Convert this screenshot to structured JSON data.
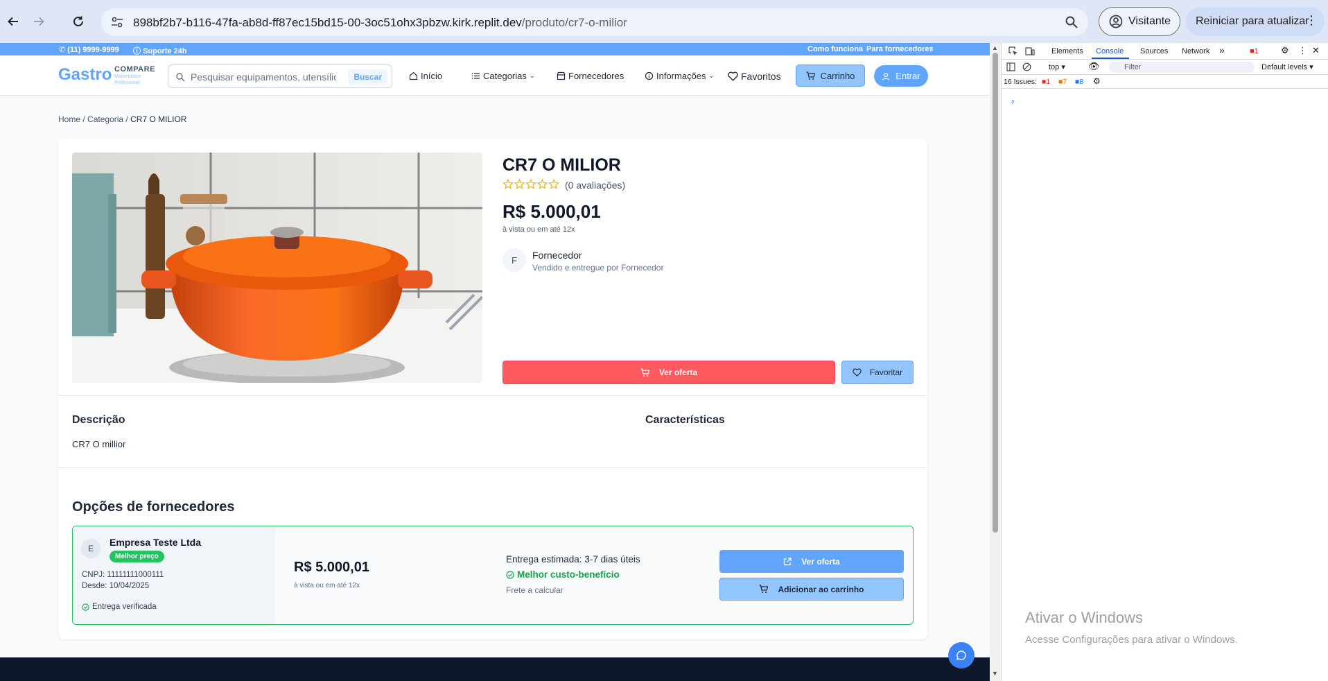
{
  "browser": {
    "url_host": "898bf2b7-b116-47fa-ab8d-ff87ec15bd15-00-3oc51ohx3pbzw.kirk.replit.dev",
    "url_path": "/produto/cr7-o-milior",
    "profile_label": "Visitante",
    "update_label": "Reiniciar para atualizar"
  },
  "topbar": {
    "phone": "(11) 9999-9999",
    "support": "Suporte 24h",
    "how_it_works": "Como funciona",
    "for_suppliers": "Para fornecedores"
  },
  "header": {
    "logo_main": "Gastro",
    "logo_compare": "COMPARE",
    "logo_sub1": "Marketplace",
    "logo_sub2": "Profissional",
    "search_placeholder": "Pesquisar equipamentos, utensílios...",
    "search_button": "Buscar",
    "nav": {
      "home": "Início",
      "categories": "Categorias",
      "suppliers": "Fornecedores",
      "info": "Informações",
      "favorites": "Favoritos"
    },
    "cart": "Carrinho",
    "login": "Entrar"
  },
  "breadcrumb": {
    "home": "Home",
    "category": "Categoria",
    "current": "CR7 O MILIOR",
    "sep": "/"
  },
  "product": {
    "title": "CR7 O MILIOR",
    "rating_count": 0,
    "reviews_label": "(0 avaliações)",
    "price": "R$ 5.000,01",
    "price_note": "à vista ou em até 12x",
    "supplier_initial": "F",
    "supplier_name": "Fornecedor",
    "supplier_sold_by": "Vendido e entregue por Fornecedor",
    "view_offer": "Ver oferta",
    "favorite": "Favoritar",
    "description_title": "Descrição",
    "description_text": "CR7 O millior",
    "characteristics_title": "Características"
  },
  "supplier_options": {
    "title": "Opções de fornecedores",
    "offers": [
      {
        "initial": "E",
        "company": "Empresa Teste Ltda",
        "badge": "Melhor preço",
        "cnpj": "CNPJ: 11111111000111",
        "since": "Desde: 10/04/2025",
        "verified": "Entrega verificada",
        "price": "R$ 5.000,01",
        "price_note": "à vista ou em até 12x",
        "delivery": "Entrega estimada: 3-7 dias úteis",
        "value_label": "Melhor custo-benefício",
        "freight": "Frete a calcular",
        "view_offer": "Ver oferta",
        "add_to_cart": "Adicionar ao carrinho"
      }
    ]
  },
  "devtools": {
    "tabs": [
      "Elements",
      "Console",
      "Sources",
      "Network"
    ],
    "errors_badge": "1",
    "context": "top",
    "filter_placeholder": "Filter",
    "levels": "Default levels",
    "issues_label": "16 Issues:",
    "issues_errors": "1",
    "issues_warnings": "7",
    "issues_info": "8"
  },
  "windows_watermark": {
    "line1": "Ativar o Windows",
    "line2": "Acesse Configurações para ativar o Windows."
  },
  "colors": {
    "brand": "#60a5fa",
    "danger": "#ff5a5f",
    "success": "#22c55e",
    "footer": "#0f172a"
  }
}
